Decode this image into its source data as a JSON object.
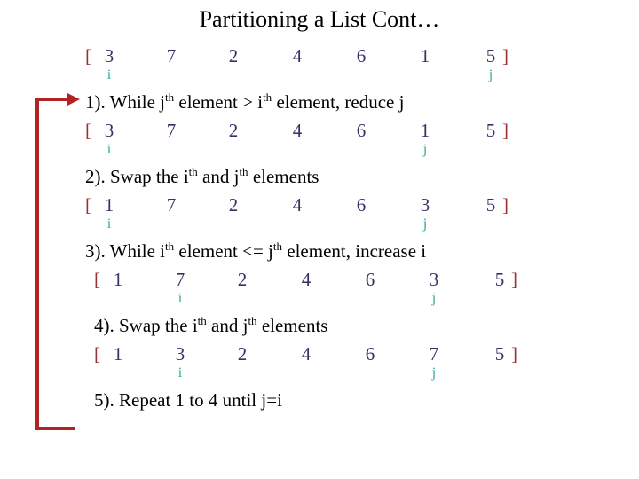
{
  "slide": {
    "title": "Partitioning a List Cont…"
  },
  "colors": {
    "number": "#333366",
    "bracket": "#993333",
    "marker": "#33a899",
    "text": "#000000",
    "arrow": "#b32222",
    "background": "#ffffff"
  },
  "brackets": {
    "open": "[",
    "close": "]"
  },
  "markers": {
    "i": "i",
    "j": "j",
    "blank": ""
  },
  "rows": [
    {
      "id": "row-1",
      "values": [
        "3",
        "7",
        "2",
        "4",
        "6",
        "1",
        "5"
      ],
      "marks": [
        "i",
        "",
        "",
        "",
        "",
        "",
        "j"
      ]
    },
    {
      "id": "row-2",
      "values": [
        "3",
        "7",
        "2",
        "4",
        "6",
        "1",
        "5"
      ],
      "marks": [
        "i",
        "",
        "",
        "",
        "",
        "j",
        ""
      ]
    },
    {
      "id": "row-3",
      "values": [
        "1",
        "7",
        "2",
        "4",
        "6",
        "3",
        "5"
      ],
      "marks": [
        "i",
        "",
        "",
        "",
        "",
        "j",
        ""
      ]
    },
    {
      "id": "row-4",
      "values": [
        "1",
        "7",
        "2",
        "4",
        "6",
        "3",
        "5"
      ],
      "marks": [
        "",
        "i",
        "",
        "",
        "",
        "j",
        ""
      ]
    },
    {
      "id": "row-5",
      "values": [
        "1",
        "3",
        "2",
        "4",
        "6",
        "7",
        "5"
      ],
      "marks": [
        "",
        "i",
        "",
        "",
        "",
        "j",
        ""
      ]
    }
  ],
  "steps": [
    {
      "id": "step-1",
      "number": "1). ",
      "parts": [
        "While j",
        "th",
        " element > i",
        "th",
        " element, reduce j"
      ],
      "plain": "1). While jth element > ith element, reduce j"
    },
    {
      "id": "step-2",
      "number": "2). ",
      "parts": [
        "Swap the i",
        "th",
        " and j",
        "th",
        " elements"
      ],
      "plain": "2). Swap the ith and jth elements"
    },
    {
      "id": "step-3",
      "number": "3). ",
      "parts": [
        "While i",
        "th",
        " element <= j",
        "th",
        " element, increase i"
      ],
      "plain": "3). While ith element <= jth element, increase i"
    },
    {
      "id": "step-4",
      "number": "4). ",
      "parts": [
        "Swap the i",
        "th",
        " and j",
        "th",
        " elements"
      ],
      "plain": "4). Swap the ith and jth elements"
    },
    {
      "id": "step-5",
      "number": "5). ",
      "parts": [
        "Repeat 1 to 4 until j=i"
      ],
      "plain": "5). Repeat 1 to 4 until j=i"
    }
  ]
}
